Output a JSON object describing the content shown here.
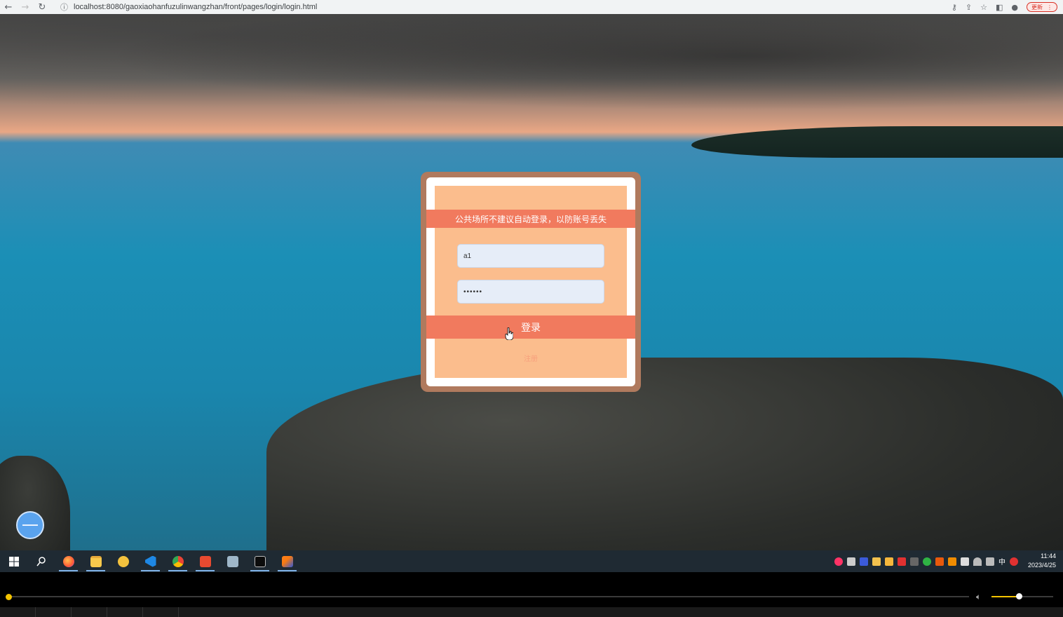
{
  "browser": {
    "url": "localhost:8080/gaoxiaohanfuzulinwangzhan/front/pages/login/login.html",
    "update_label": "更新"
  },
  "login": {
    "notice": "公共场所不建议自动登录，以防账号丢失",
    "username_value": "a1",
    "password_value": "••••••",
    "login_label": "登录",
    "register_label": "注册"
  },
  "taskbar": {
    "apps": [
      "start",
      "search",
      "firefox",
      "file-explorer",
      "qqbrowser",
      "vscode",
      "chrome",
      "wps",
      "notes",
      "terminal",
      "ide"
    ],
    "tray_ime": "中",
    "time": "11:44",
    "date": "2023/4/25"
  },
  "player": {
    "progress": 0.0,
    "volume": 0.45
  }
}
